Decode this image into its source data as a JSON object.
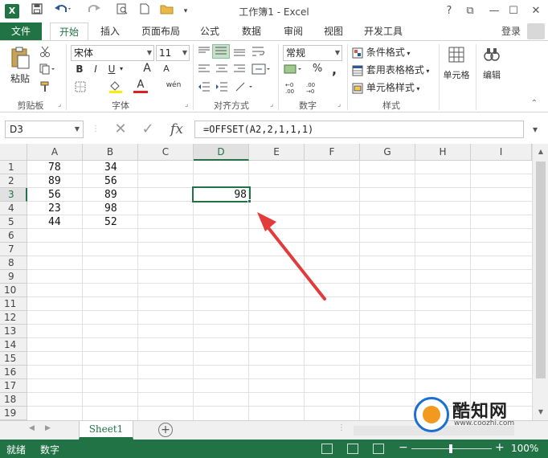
{
  "window": {
    "title": "工作簿1 - Excel",
    "app_logo": "X",
    "controls": {
      "help": "?",
      "restore_ribbon": "⧉",
      "minimize": "—",
      "maximize": "☐",
      "close": "✕"
    }
  },
  "qat": {
    "save_icon": "save-icon",
    "undo_icon": "undo-icon",
    "redo_icon": "redo-icon"
  },
  "tabs": {
    "file": "文件",
    "home": "开始",
    "insert": "插入",
    "page_layout": "页面布局",
    "formulas": "公式",
    "data": "数据",
    "review": "审阅",
    "view": "视图",
    "developer": "开发工具",
    "login": "登录"
  },
  "ribbon": {
    "clipboard": {
      "label": "剪贴板",
      "paste": "粘贴"
    },
    "font": {
      "label": "字体",
      "font_name": "宋体",
      "font_size": "11",
      "bold": "B",
      "italic": "I",
      "underline": "U",
      "grow": "A",
      "shrink": "A",
      "font_color": "A",
      "phonetic": "wén"
    },
    "alignment": {
      "label": "对齐方式"
    },
    "number": {
      "label": "数字",
      "format": "常规",
      "percent": "%",
      "comma": ","
    },
    "styles": {
      "label": "样式",
      "conditional": "条件格式",
      "table": "套用表格格式",
      "cell_styles": "单元格样式"
    },
    "cells": {
      "label": "单元格"
    },
    "editing": {
      "label": "编辑"
    }
  },
  "formula_bar": {
    "name_box": "D3",
    "fx": "fx",
    "formula": "=OFFSET(A2,2,1,1,1)"
  },
  "grid": {
    "columns": [
      "A",
      "B",
      "C",
      "D",
      "E",
      "F",
      "G",
      "H",
      "I"
    ],
    "rows": [
      "1",
      "2",
      "3",
      "4",
      "5",
      "6",
      "7",
      "8",
      "9",
      "10",
      "11",
      "12",
      "13",
      "14",
      "15",
      "16",
      "17",
      "18",
      "19"
    ],
    "col_a": [
      "78",
      "89",
      "56",
      "23",
      "44"
    ],
    "col_b": [
      "34",
      "56",
      "89",
      "98",
      "52"
    ],
    "d3": "98"
  },
  "sheets": {
    "active": "Sheet1",
    "add": "+"
  },
  "status": {
    "ready": "就绪",
    "numlock": "数字",
    "zoom": "100%",
    "zoom_minus": "−",
    "zoom_plus": "+"
  },
  "watermark": {
    "title": "酷知网",
    "url": "www.coozhi.com"
  },
  "colors": {
    "excel_green": "#217346",
    "arrow_red": "#e23b3b"
  }
}
